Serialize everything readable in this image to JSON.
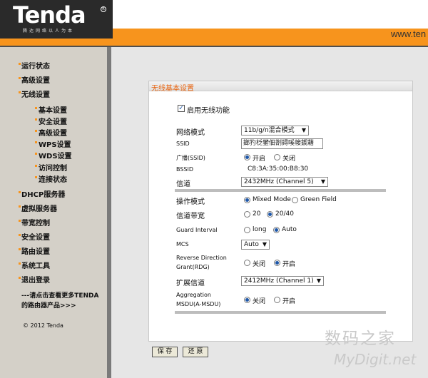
{
  "header": {
    "logo": "Tenda",
    "slogan": "腾达网络以人为本",
    "url": "www.ten"
  },
  "sidebar": {
    "items": [
      "运行状态",
      "高级设置",
      "无线设置"
    ],
    "subitems": [
      "基本设置",
      "安全设置",
      "高级设置",
      "WPS设置",
      "WDS设置",
      "访问控制",
      "连接状态"
    ],
    "items2": [
      "DHCP服务器",
      "虚拟服务器",
      "带宽控制",
      "安全设置",
      "路由设置",
      "系统工具",
      "退出登录"
    ],
    "promo": "---请点击查看更多TENDA的路由器产品>>>",
    "copyright": "© 2012 Tenda"
  },
  "panel": {
    "title": "无线基本设置",
    "enable_label": "启用无线功能",
    "network_mode_label": "网络模式",
    "network_mode_value": "11b/g/n混合模式",
    "ssid_label": "SSID",
    "ssid_value": "鎯犳柉鐢佃剳鐞嗘帹鍥藉",
    "broadcast_label": "广播(SSID)",
    "broadcast_on": "开启",
    "broadcast_off": "关闭",
    "bssid_label": "BSSID",
    "bssid_value": "C8:3A:35:00:B8:30",
    "channel_label": "信道",
    "channel_value": "2432MHz (Channel 5)",
    "op_mode_label": "操作模式",
    "op_mixed": "Mixed Mode",
    "op_green": "Green Field",
    "bandwidth_label": "信道带宽",
    "bw_20": "20",
    "bw_2040": "20/40",
    "guard_label": "Guard Interval",
    "guard_long": "long",
    "guard_auto": "Auto",
    "mcs_label": "MCS",
    "mcs_value": "Auto",
    "rdg_label1": "Reverse Direction",
    "rdg_label2": "Grant(RDG)",
    "rdg_off": "关闭",
    "rdg_on": "开启",
    "ext_channel_label": "扩展信道",
    "ext_channel_value": "2412MHz (Channel 1)",
    "amsdu_label1": "Aggregation",
    "amsdu_label2": "MSDU(A-MSDU)",
    "amsdu_off": "关闭",
    "amsdu_on": "开启"
  },
  "buttons": {
    "save": "保 存",
    "restore": "还 原"
  },
  "watermark": {
    "line1": "数码之家",
    "line2": "MyDigit.net"
  }
}
